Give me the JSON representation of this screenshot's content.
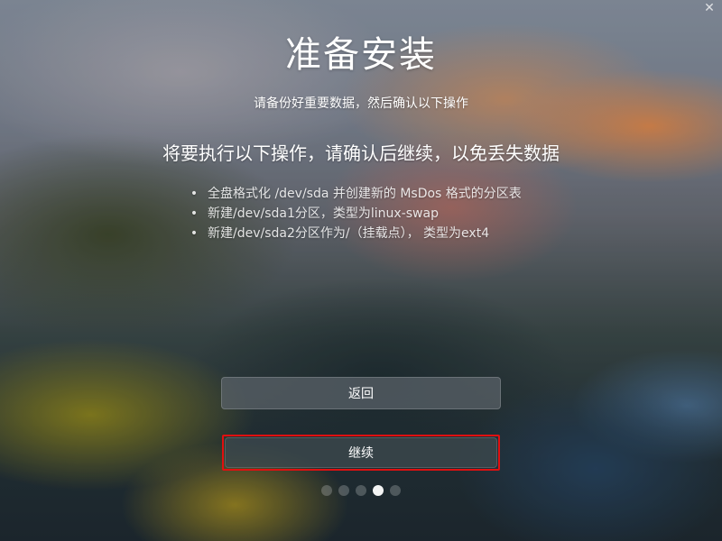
{
  "window": {
    "close_symbol": "✕"
  },
  "page": {
    "title": "准备安装",
    "subtitle": "请备份好重要数据，然后确认以下操作",
    "heading": "将要执行以下操作，请确认后继续，以免丢失数据"
  },
  "operations": [
    "全盘格式化 /dev/sda 并创建新的 MsDos 格式的分区表",
    "新建/dev/sda1分区，类型为linux-swap",
    "新建/dev/sda2分区作为/（挂载点）， 类型为ext4"
  ],
  "buttons": {
    "back_label": "返回",
    "continue_label": "继续"
  },
  "pagination": {
    "total": 5,
    "active_index": 3
  },
  "colors": {
    "highlight": "#e01010"
  },
  "icons": {
    "close": "close-icon",
    "bullet": "bullet-icon"
  }
}
